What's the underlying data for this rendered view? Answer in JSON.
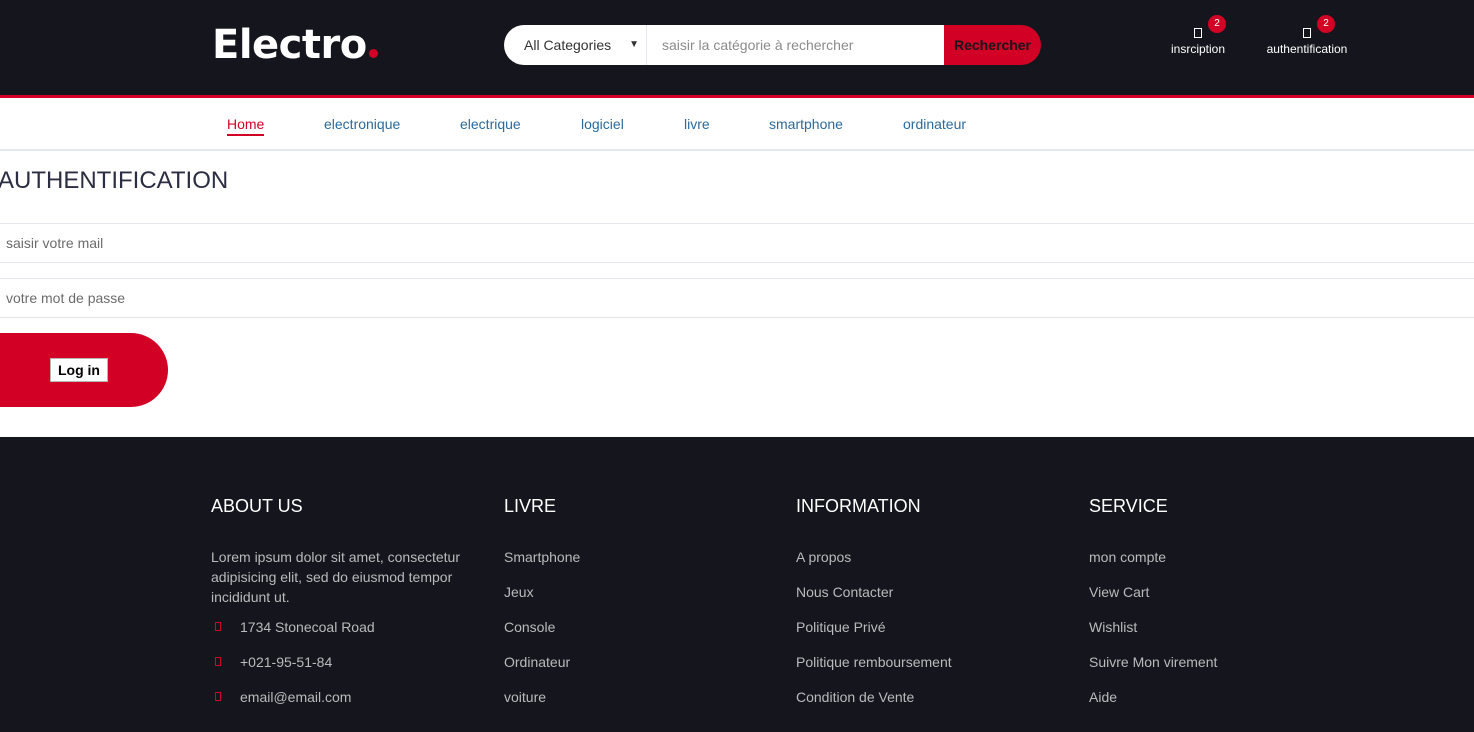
{
  "brand": {
    "name": "Electro",
    "accent": "#d10024",
    "dark": "#15161d"
  },
  "search": {
    "category": "All Categories",
    "placeholder": "saisir la catégorie à rechercher",
    "button_label": "Rechercher"
  },
  "header_links": [
    {
      "label": "insrciption",
      "badge": "2",
      "icon": "heart-icon"
    },
    {
      "label": "authentification",
      "badge": "2",
      "icon": "cart-icon"
    }
  ],
  "nav": {
    "items": [
      "Home",
      "electronique",
      "electrique",
      "logiciel",
      "livre",
      "smartphone",
      "ordinateur"
    ],
    "active_index": 0
  },
  "auth": {
    "title": "AUTHENTIFICATION",
    "email_placeholder": "saisir votre mail",
    "password_placeholder": "votre mot de passe",
    "login_label": "Log in"
  },
  "footer": {
    "about": {
      "title": "ABOUT US",
      "text": "Lorem ipsum dolor sit amet, consectetur adipisicing elit, sed do eiusmod tempor incididunt ut.",
      "contacts": [
        {
          "icon": "map-marker-icon",
          "text": "1734 Stonecoal Road"
        },
        {
          "icon": "phone-icon",
          "text": "+021-95-51-84"
        },
        {
          "icon": "envelope-icon",
          "text": "email@email.com"
        }
      ]
    },
    "livre": {
      "title": "LIVRE",
      "links": [
        "Smartphone",
        "Jeux",
        "Console",
        "Ordinateur",
        "voiture"
      ]
    },
    "information": {
      "title": "INFORMATION",
      "links": [
        "A propos",
        "Nous Contacter",
        "Politique Privé",
        "Politique remboursement",
        "Condition de Vente"
      ]
    },
    "service": {
      "title": "SERVICE",
      "links": [
        "mon compte",
        "View Cart",
        "Wishlist",
        "Suivre Mon virement",
        "Aide"
      ]
    }
  }
}
